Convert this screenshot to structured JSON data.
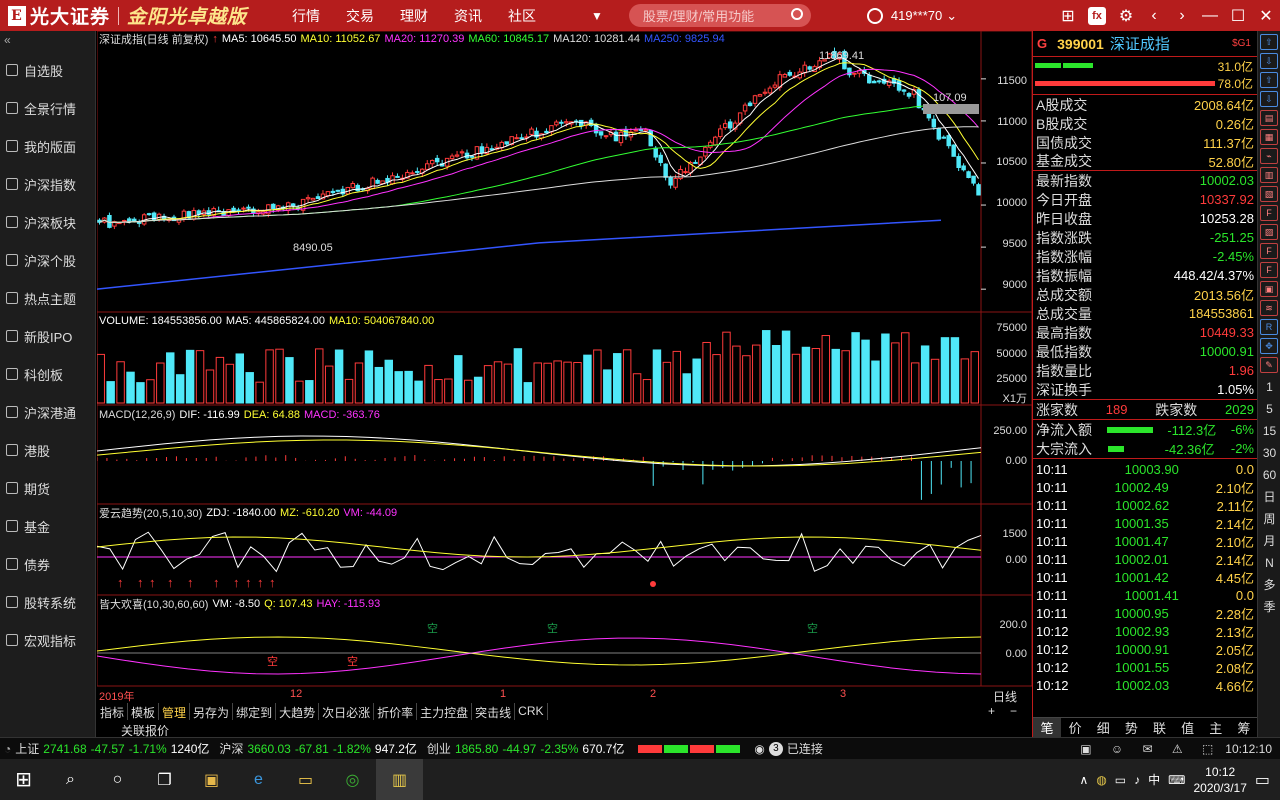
{
  "app": {
    "logo_text": "光大证券",
    "logo_version": "金阳光卓越版",
    "menu": [
      "行情",
      "交易",
      "理财",
      "资讯",
      "社区"
    ],
    "search_placeholder": "股票/理财/常用功能",
    "user": "419***70"
  },
  "sidebar": {
    "items": [
      {
        "label": "自选股",
        "icon": "star-icon"
      },
      {
        "label": "全景行情",
        "icon": "panorama-icon"
      },
      {
        "label": "我的版面",
        "icon": "layout-icon"
      },
      {
        "label": "沪深指数",
        "icon": "index-chart-icon"
      },
      {
        "label": "沪深板块",
        "icon": "sh-block-icon"
      },
      {
        "label": "沪深个股",
        "icon": "stock-icon"
      },
      {
        "label": "热点主题",
        "icon": "fire-icon"
      },
      {
        "label": "新股IPO",
        "icon": "ipo-icon"
      },
      {
        "label": "科创板",
        "icon": "star-board-icon"
      },
      {
        "label": "沪深港通",
        "icon": "connect-icon"
      },
      {
        "label": "港股",
        "icon": "hk-icon"
      },
      {
        "label": "期货",
        "icon": "futures-icon"
      },
      {
        "label": "基金",
        "icon": "fund-icon"
      },
      {
        "label": "债券",
        "icon": "bond-icon"
      },
      {
        "label": "股转系统",
        "icon": "neeq-icon"
      },
      {
        "label": "宏观指标",
        "icon": "macro-icon"
      }
    ]
  },
  "main_panel": {
    "title": "深证成指(日线 前复权)",
    "ma": [
      {
        "label": "MA5: 10645.50",
        "color": "#ffffff"
      },
      {
        "label": "MA10: 11052.67",
        "color": "#ffff33"
      },
      {
        "label": "MA20: 11270.39",
        "color": "#ff33ff"
      },
      {
        "label": "MA60: 10845.17",
        "color": "#33ff33"
      },
      {
        "label": "MA120: 10281.44",
        "color": "#dddddd"
      },
      {
        "label": "MA250: 9825.94",
        "color": "#3355ff"
      }
    ],
    "high_label": "11869.41",
    "low_label": "8490.05",
    "price_tag": "107.09",
    "y_ticks": [
      "11500",
      "11000",
      "10500",
      "10000",
      "9500",
      "9000"
    ]
  },
  "volume_panel": {
    "labels": [
      "VOLUME: 184553856.00",
      "MA5: 445865824.00",
      "MA10: 504067840.00"
    ],
    "y_ticks": [
      "75000",
      "50000",
      "25000"
    ],
    "unit": "X1万"
  },
  "macd_panel": {
    "labels": [
      "MACD(12,26,9)",
      "DIF: -116.99",
      "DEA: 64.88",
      "MACD: -363.76"
    ],
    "y_ticks": [
      "250.00",
      "0.00"
    ]
  },
  "aiyun_panel": {
    "labels": [
      "爱云趋势(20,5,10,30)",
      "ZDJ: -1840.00",
      "MZ: -610.20",
      "VM: -44.09"
    ],
    "y_ticks": [
      "1500",
      "0.00"
    ]
  },
  "jiehuan_panel": {
    "labels": [
      "皆大欢喜(10,30,60,60)",
      "VM: -8.50",
      "Q: 107.43",
      "HAY: -115.93"
    ],
    "y_ticks": [
      "200.0",
      "0.00"
    ],
    "marker_text": "空"
  },
  "x_axis": [
    "2019年",
    "12",
    "1",
    "2",
    "3"
  ],
  "period": "日线",
  "bottom_tabs": [
    "指标",
    "模板",
    "管理",
    "另存为",
    "绑定到",
    "大趋势",
    "次日必涨",
    "折价率",
    "主力控盘",
    "突击线",
    "CRK"
  ],
  "active_tab": "管理",
  "guanlian": "关联报价",
  "quote": {
    "g_label": "G",
    "code": "399001",
    "name": "深证成指",
    "sig": "$G1",
    "bar_values": [
      "31.0亿",
      "78.0亿"
    ],
    "rows": [
      {
        "label": "A股成交",
        "value": "2008.64亿",
        "color": "yellow"
      },
      {
        "label": "B股成交",
        "value": "0.26亿",
        "color": "yellow"
      },
      {
        "label": "国债成交",
        "value": "111.37亿",
        "color": "yellow"
      },
      {
        "label": "基金成交",
        "value": "52.80亿",
        "color": "yellow"
      },
      {
        "label": "最新指数",
        "value": "10002.03",
        "color": "green"
      },
      {
        "label": "今日开盘",
        "value": "10337.92",
        "color": "red"
      },
      {
        "label": "昨日收盘",
        "value": "10253.28",
        "color": "white"
      },
      {
        "label": "指数涨跌",
        "value": "-251.25",
        "color": "green"
      },
      {
        "label": "指数涨幅",
        "value": "-2.45%",
        "color": "green"
      },
      {
        "label": "指数振幅",
        "value": "448.42/4.37%",
        "color": "white"
      },
      {
        "label": "总成交额",
        "value": "2013.56亿",
        "color": "yellow"
      },
      {
        "label": "总成交量",
        "value": "184553861",
        "color": "yellow"
      },
      {
        "label": "最高指数",
        "value": "10449.33",
        "color": "red"
      },
      {
        "label": "最低指数",
        "value": "10000.91",
        "color": "green"
      },
      {
        "label": "指数量比",
        "value": "1.96",
        "color": "red"
      },
      {
        "label": "深证换手",
        "value": "1.05%",
        "color": "white"
      }
    ],
    "up_label": "涨家数",
    "up": "189",
    "down_label": "跌家数",
    "down": "2029",
    "net_inflow_label": "净流入额",
    "net_inflow": "-112.3亿",
    "net_inflow_pct": "-6%",
    "block_inflow_label": "大宗流入",
    "block_inflow": "-42.36亿",
    "block_inflow_pct": "-2%",
    "ticks": [
      {
        "t": "10:11",
        "p": "10003.90",
        "v": "0.0"
      },
      {
        "t": "10:11",
        "p": "10002.49",
        "v": "2.10亿"
      },
      {
        "t": "10:11",
        "p": "10002.62",
        "v": "2.11亿"
      },
      {
        "t": "10:11",
        "p": "10001.35",
        "v": "2.14亿"
      },
      {
        "t": "10:11",
        "p": "10001.47",
        "v": "2.10亿"
      },
      {
        "t": "10:11",
        "p": "10002.01",
        "v": "2.14亿"
      },
      {
        "t": "10:11",
        "p": "10001.42",
        "v": "4.45亿"
      },
      {
        "t": "10:11",
        "p": "10001.41",
        "v": "0.0"
      },
      {
        "t": "10:11",
        "p": "10000.95",
        "v": "2.28亿"
      },
      {
        "t": "10:12",
        "p": "10002.93",
        "v": "2.13亿"
      },
      {
        "t": "10:12",
        "p": "10000.91",
        "v": "2.05亿"
      },
      {
        "t": "10:12",
        "p": "10001.55",
        "v": "2.08亿"
      },
      {
        "t": "10:12",
        "p": "10002.03",
        "v": "4.66亿"
      }
    ],
    "bottom_tabs": [
      "笔",
      "价",
      "细",
      "势",
      "联",
      "值",
      "主",
      "筹"
    ]
  },
  "toolstrip": [
    "1",
    "5",
    "15",
    "30",
    "60",
    "日",
    "周",
    "月",
    "N",
    "多",
    "季"
  ],
  "status": {
    "sh_label": "上证",
    "sh_val": "2741.68",
    "sh_chg": "-47.57",
    "sh_pct": "-1.71%",
    "sh_amt": "1240亿",
    "hs_label": "沪深",
    "hs_val": "3660.03",
    "hs_chg": "-67.81",
    "hs_pct": "-1.82%",
    "hs_amt": "947.2亿",
    "cy_label": "创业",
    "cy_val": "1865.80",
    "cy_chg": "-44.97",
    "cy_pct": "-2.35%",
    "cy_amt": "670.7亿",
    "conn": "已连接",
    "conn_num": "3",
    "time": "10:12:10"
  },
  "taskbar": {
    "time": "10:12",
    "date": "2020/3/17",
    "ime": "中"
  },
  "colors": {
    "up": "#ff3b3b",
    "down": "#50e8f8",
    "panel_border": "#a01818"
  }
}
